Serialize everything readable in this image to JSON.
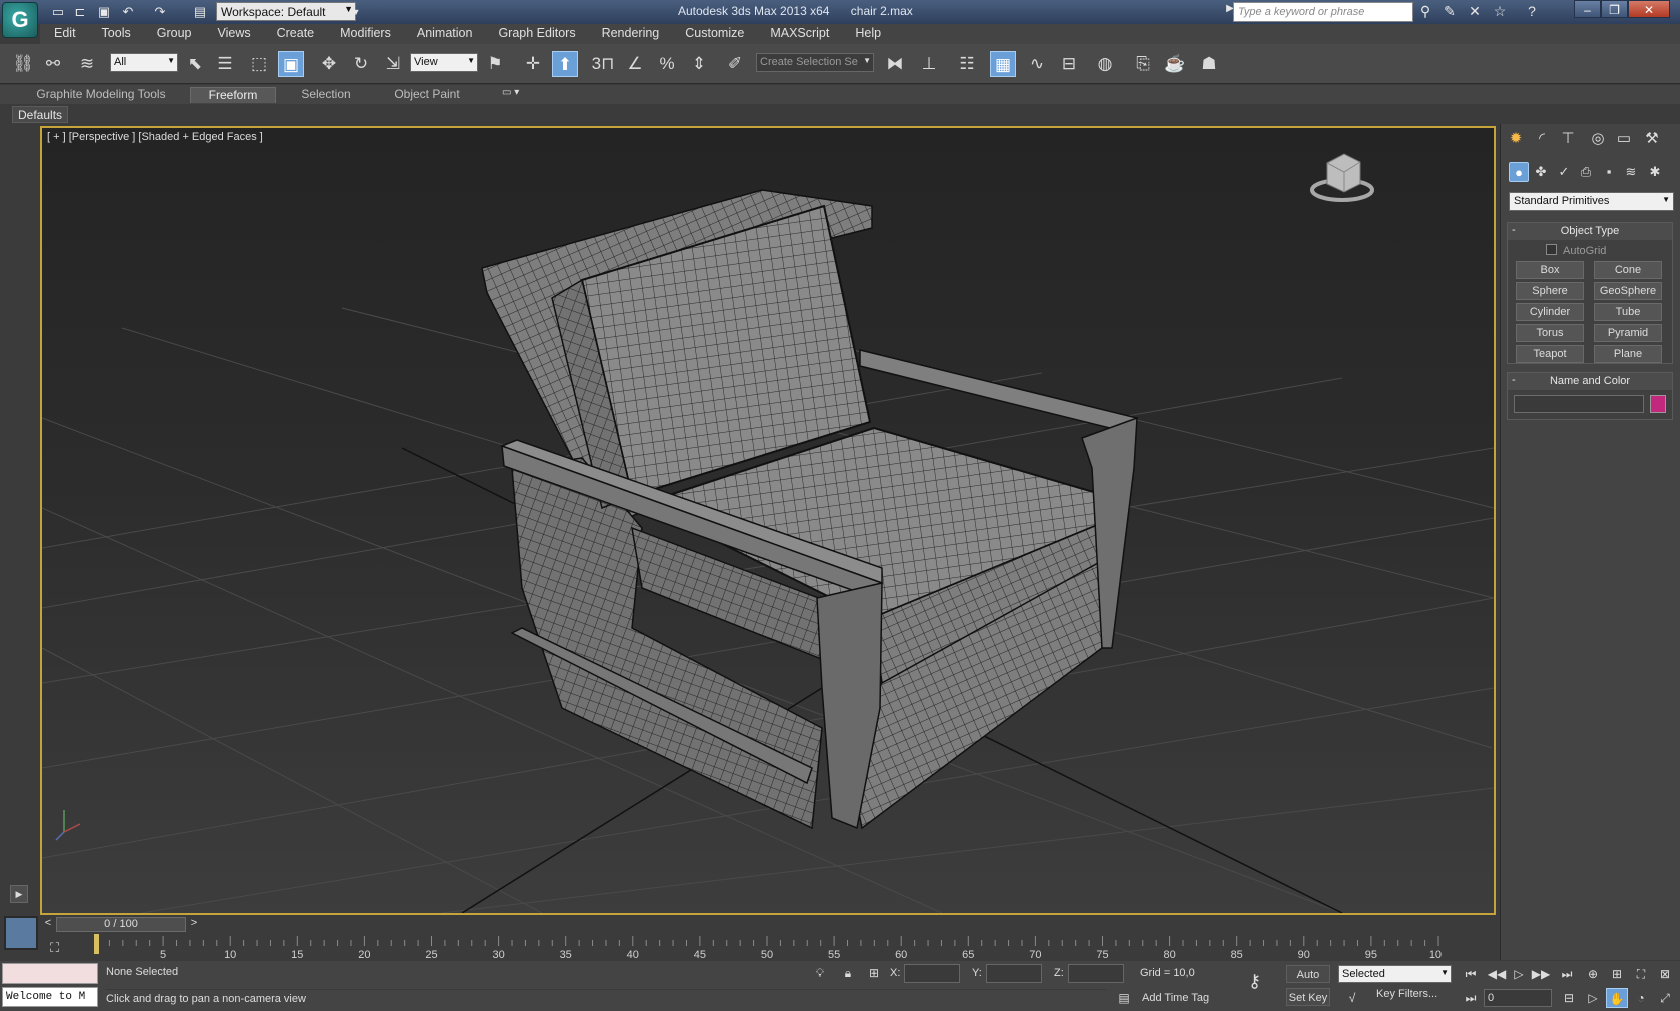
{
  "titlebar": {
    "workspace": "Workspace: Default",
    "app_title": "Autodesk 3ds Max  2013 x64",
    "file_name": "chair 2.max",
    "search_placeholder": "Type a keyword or phrase"
  },
  "menu": [
    "Edit",
    "Tools",
    "Group",
    "Views",
    "Create",
    "Modifiers",
    "Animation",
    "Graph Editors",
    "Rendering",
    "Customize",
    "MAXScript",
    "Help"
  ],
  "toolbar": {
    "filter_value": "All",
    "refcoord_value": "View",
    "snap_angle": "3",
    "selection_set_placeholder": "Create Selection Se"
  },
  "ribbon": {
    "tabs": [
      "Graphite Modeling Tools",
      "Freeform",
      "Selection",
      "Object Paint"
    ],
    "active_tab": "Freeform",
    "defaults": "Defaults"
  },
  "viewport": {
    "label": "[ + ] [Perspective ] [Shaded + Edged Faces ]",
    "accent": "#c7a33c"
  },
  "command_panel": {
    "category": "Standard Primitives",
    "object_type_title": "Object Type",
    "autogrid": "AutoGrid",
    "objects": [
      "Box",
      "Cone",
      "Sphere",
      "GeoSphere",
      "Cylinder",
      "Tube",
      "Torus",
      "Pyramid",
      "Teapot",
      "Plane"
    ],
    "name_color_title": "Name and Color",
    "object_color": "#c2297e"
  },
  "timeline": {
    "position": "0 / 100",
    "ticks": [
      "5",
      "10",
      "15",
      "20",
      "25",
      "30",
      "35",
      "40",
      "45",
      "50",
      "55",
      "60",
      "65",
      "70",
      "75",
      "80",
      "85",
      "90",
      "95",
      "100"
    ]
  },
  "status": {
    "welcome": "Welcome to M",
    "selection": "None Selected",
    "prompt": "Click and drag to pan a non-camera view",
    "x_label": "X:",
    "y_label": "Y:",
    "z_label": "Z:",
    "grid": "Grid = 10,0",
    "add_time_tag": "Add Time Tag",
    "auto_key": "Auto Key",
    "set_key": "Set Key",
    "key_mode": "Selected",
    "key_filters": "Key Filters...",
    "current_frame": "0"
  }
}
